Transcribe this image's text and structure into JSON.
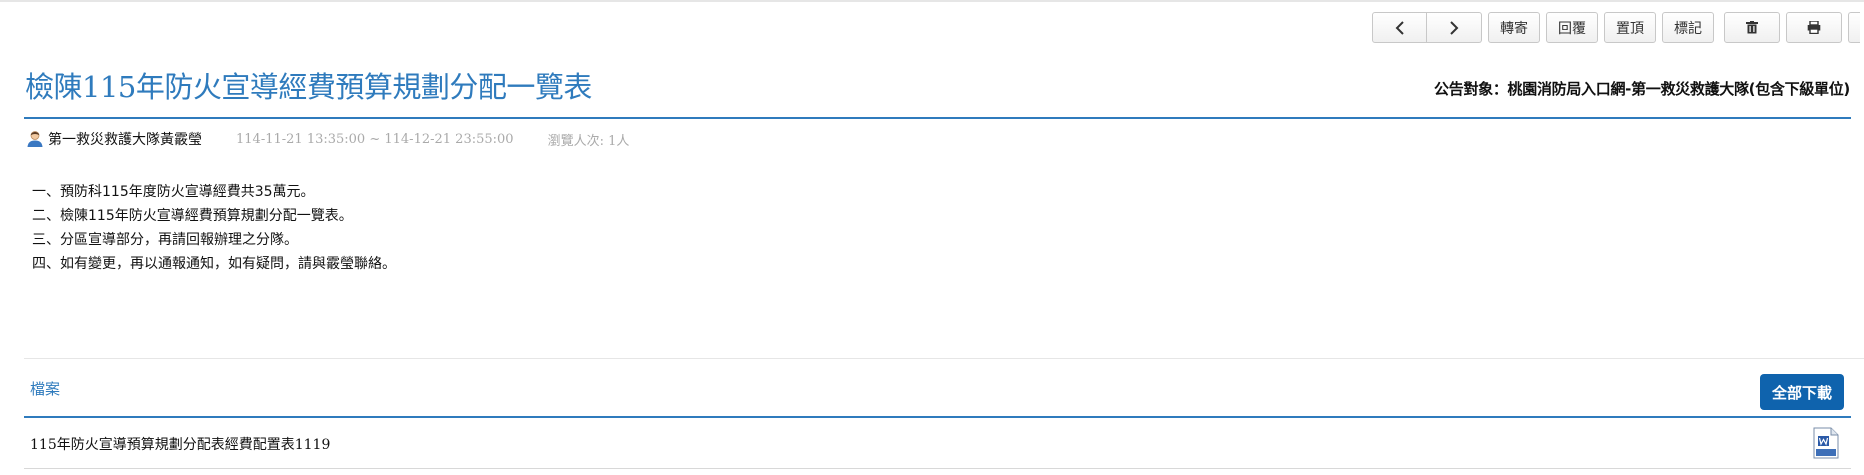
{
  "toolbar": {
    "prev_icon": "chevron-left-icon",
    "next_icon": "chevron-right-icon",
    "forward_label": "轉寄",
    "reply_label": "回覆",
    "pin_label": "置頂",
    "mark_label": "標記",
    "delete_icon": "trash-icon",
    "print_icon": "printer-icon"
  },
  "post": {
    "title": "檢陳115年防火宣導經費預算規劃分配一覽表",
    "audience": "公告對象：桃園消防局入口網-第一救災救護大隊(包含下級單位)",
    "author": "第一救災救護大隊黃霰瑩",
    "date_range": "114-11-21 13:35:00 ~ 114-12-21 23:55:00",
    "views": "瀏覽人次: 1人",
    "lines": [
      "一、預防科115年度防火宣導經費共35萬元。",
      "二、檢陳115年防火宣導經費預算規劃分配一覽表。",
      "三、分區宣導部分，再請回報辦理之分隊。",
      "四、如有變更，再以通報通知，如有疑問，請與霰瑩聯絡。"
    ]
  },
  "files": {
    "label": "檔案",
    "download_all_label": "全部下載",
    "items": [
      {
        "name": "115年防火宣導預算規劃分配表經費配置表1119",
        "icon": "doc-file-icon"
      }
    ]
  },
  "colors": {
    "accent": "#2f7bbd",
    "button_primary": "#0f63ad"
  }
}
